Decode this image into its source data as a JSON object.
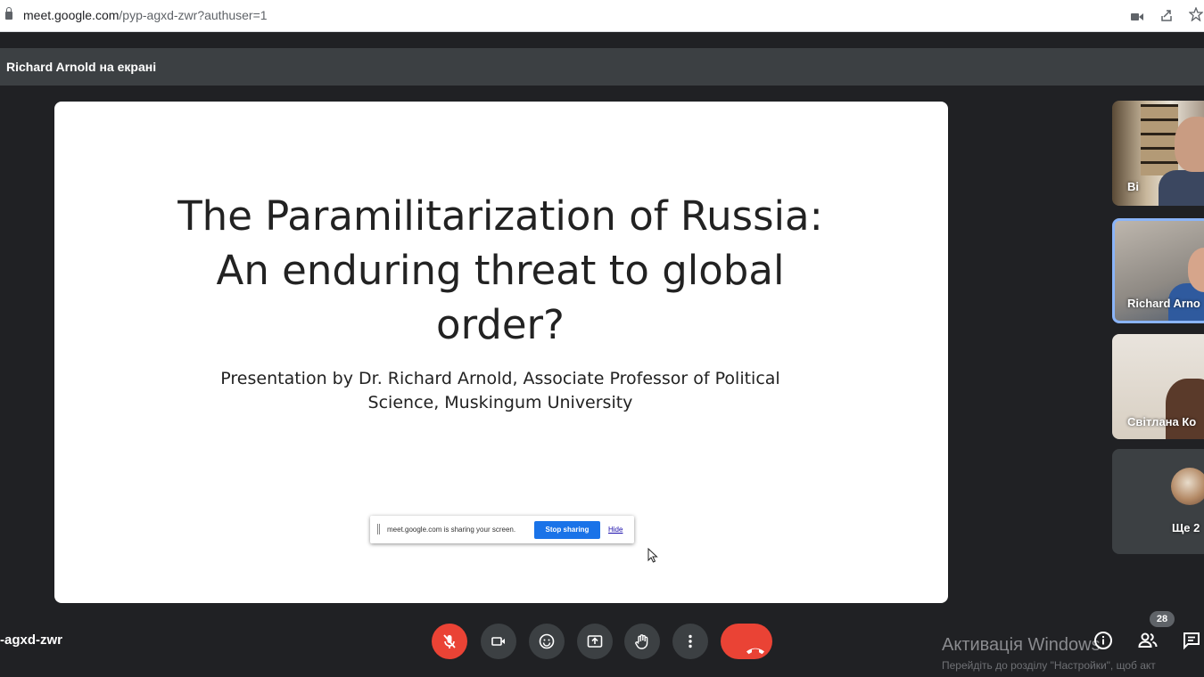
{
  "browser": {
    "url_host": "meet.google.com",
    "url_path": "/pyp-agxd-zwr?authuser=1",
    "icons": [
      "lock-icon",
      "camera-icon",
      "share-icon",
      "star-icon"
    ]
  },
  "presenter_bar": {
    "label": "Richard Arnold на екрані"
  },
  "slide": {
    "title_lines": [
      "The Paramilitarization of Russia:",
      "An enduring threat to global",
      "order?"
    ],
    "subtitle_lines": [
      "Presentation by Dr. Richard Arnold, Associate Professor of Political",
      "Science, Muskingum University"
    ]
  },
  "share_notice": {
    "message": "meet.google.com is sharing your screen.",
    "stop_label": "Stop sharing",
    "hide_label": "Hide"
  },
  "participants": [
    {
      "name": "Ві"
    },
    {
      "name": "Richard Arno"
    },
    {
      "name": "Світлана Ко"
    },
    {
      "name": "Ще 2"
    }
  ],
  "meeting_code": "-agxd-zwr",
  "controls": {
    "mic": "mic-off-icon",
    "camera": "camera-icon",
    "emoji": "emoji-icon",
    "present": "present-icon",
    "hand": "raise-hand-icon",
    "more": "more-vert-icon",
    "leave": "call-end-icon"
  },
  "people_count": "28",
  "watermark": {
    "line1": "Активація Windows",
    "line2": "Перейдіть до розділу \"Настройки\", щоб акт"
  },
  "colors": {
    "background": "#202124",
    "danger": "#ea4335",
    "accent": "#1a73e8",
    "active_tile_border": "#8ab4f8"
  }
}
